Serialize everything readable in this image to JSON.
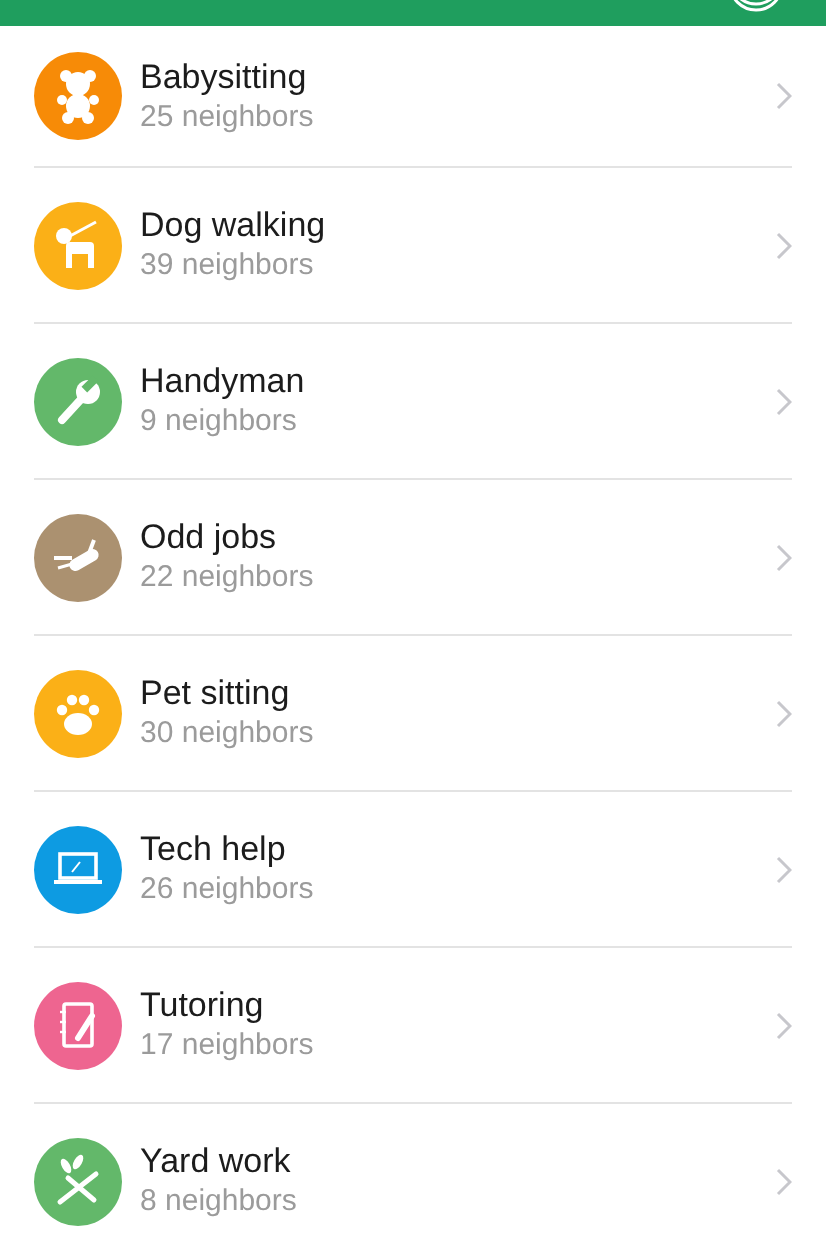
{
  "categories": [
    {
      "kind": "bear",
      "color": "#f78b07",
      "title": "Babysitting",
      "subtitle": "25 neighbors"
    },
    {
      "kind": "dog",
      "color": "#fbb017",
      "title": "Dog walking",
      "subtitle": "39 neighbors"
    },
    {
      "kind": "wrench",
      "color": "#63b86a",
      "title": "Handyman",
      "subtitle": "9 neighbors"
    },
    {
      "kind": "knife",
      "color": "#ab9170",
      "title": "Odd jobs",
      "subtitle": "22 neighbors"
    },
    {
      "kind": "paw",
      "color": "#fbb017",
      "title": "Pet sitting",
      "subtitle": "30 neighbors"
    },
    {
      "kind": "laptop",
      "color": "#0d9be2",
      "title": "Tech help",
      "subtitle": "26 neighbors"
    },
    {
      "kind": "notebook",
      "color": "#ee6590",
      "title": "Tutoring",
      "subtitle": "17 neighbors"
    },
    {
      "kind": "shears",
      "color": "#63b86a",
      "title": "Yard work",
      "subtitle": "8 neighbors"
    }
  ]
}
